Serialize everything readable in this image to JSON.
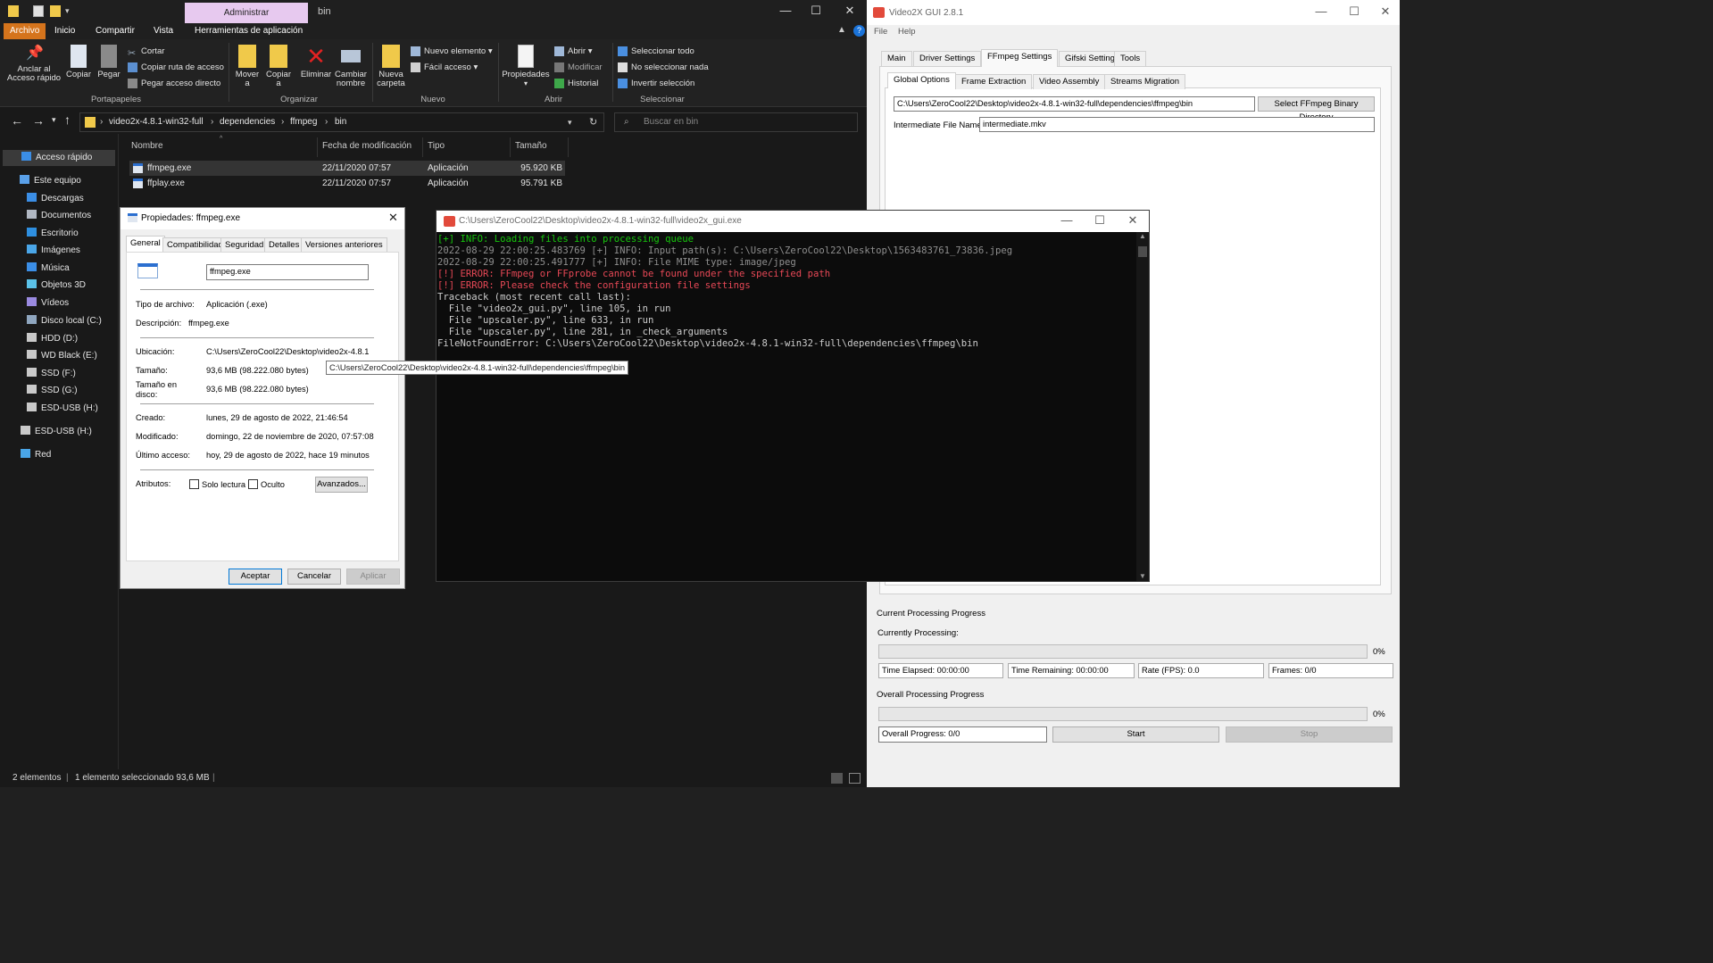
{
  "explorer": {
    "title": "bin",
    "context_tab": "Administrar",
    "tabs": [
      "Archivo",
      "Inicio",
      "Compartir",
      "Vista",
      "Herramientas de aplicación"
    ],
    "ribbon": {
      "pin": "Anclar al Acceso rápido",
      "copy": "Copiar",
      "paste": "Pegar",
      "cut": "Cortar",
      "copy_path": "Copiar ruta de acceso",
      "paste_shortcut": "Pegar acceso directo",
      "move_to": "Mover a",
      "copy_to": "Copiar a",
      "delete": "Eliminar",
      "rename": "Cambiar nombre",
      "new_folder": "Nueva carpeta",
      "new_item": "Nuevo elemento",
      "easy_access": "Fácil acceso",
      "properties": "Propiedades",
      "open": "Abrir",
      "edit": "Modificar",
      "history": "Historial",
      "select_all": "Seleccionar todo",
      "select_none": "No seleccionar nada",
      "invert_selection": "Invertir selección",
      "groups": [
        "Portapapeles",
        "Organizar",
        "Nuevo",
        "Abrir",
        "Seleccionar"
      ]
    },
    "breadcrumb": [
      "video2x-4.8.1-win32-full",
      "dependencies",
      "ffmpeg",
      "bin"
    ],
    "search_placeholder": "Buscar en bin",
    "nav": [
      {
        "label": "Acceso rápido",
        "color": "#3b8ee6"
      },
      {
        "label": "Este equipo",
        "color": "#5aa0e8"
      },
      {
        "label": "Descargas",
        "color": "#3b8ee6"
      },
      {
        "label": "Documentos",
        "color": "#b0b7c2"
      },
      {
        "label": "Escritorio",
        "color": "#2e8fe0"
      },
      {
        "label": "Imágenes",
        "color": "#4aa6e8"
      },
      {
        "label": "Música",
        "color": "#3b8ee6"
      },
      {
        "label": "Objetos 3D",
        "color": "#5bc2e8"
      },
      {
        "label": "Vídeos",
        "color": "#9a8ae0"
      },
      {
        "label": "Disco local (C:)",
        "color": "#8fa6bf"
      },
      {
        "label": "HDD (D:)",
        "color": "#c9c9c9"
      },
      {
        "label": "WD Black (E:)",
        "color": "#c9c9c9"
      },
      {
        "label": "SSD (F:)",
        "color": "#c9c9c9"
      },
      {
        "label": "SSD (G:)",
        "color": "#c9c9c9"
      },
      {
        "label": "ESD-USB (H:)",
        "color": "#c9c9c9"
      },
      {
        "label": "ESD-USB (H:)",
        "color": "#c9c9c9"
      },
      {
        "label": "Red",
        "color": "#4aa6e8"
      }
    ],
    "columns": [
      "Nombre",
      "Fecha de modificación",
      "Tipo",
      "Tamaño"
    ],
    "files": [
      {
        "name": "ffmpeg.exe",
        "date": "22/11/2020 07:57",
        "type": "Aplicación",
        "size": "95.920 KB"
      },
      {
        "name": "ffplay.exe",
        "date": "22/11/2020 07:57",
        "type": "Aplicación",
        "size": "95.791 KB"
      }
    ],
    "status": {
      "count": "2 elementos",
      "selected": "1 elemento seleccionado  93,6 MB"
    }
  },
  "properties": {
    "title": "Propiedades: ffmpeg.exe",
    "tabs": [
      "General",
      "Compatibilidad",
      "Seguridad",
      "Detalles",
      "Versiones anteriores"
    ],
    "filename": "ffmpeg.exe",
    "labels": {
      "type": "Tipo de archivo:",
      "description": "Descripción:",
      "location": "Ubicación:",
      "size": "Tamaño:",
      "size_on_disk": "Tamaño en disco:",
      "created": "Creado:",
      "modified": "Modificado:",
      "accessed": "Último acceso:",
      "attributes": "Atributos:"
    },
    "values": {
      "type": "Aplicación (.exe)",
      "description": "ffmpeg.exe",
      "location": "C:\\Users\\ZeroCool22\\Desktop\\video2x-4.8.1-…",
      "size": "93,6 MB (98.222.080 bytes)",
      "size_on_disk": "93,6 MB (98.222.080 bytes)",
      "created": "lunes, 29 de agosto de 2022, 21:46:54",
      "modified": "domingo, 22 de noviembre de 2020, 07:57:08",
      "accessed": "hoy, 29 de agosto de 2022, hace 19 minutos"
    },
    "readonly": "Solo lectura",
    "hidden": "Oculto",
    "advanced": "Avanzados...",
    "ok": "Aceptar",
    "cancel": "Cancelar",
    "apply": "Aplicar"
  },
  "tooltip": "C:\\Users\\ZeroCool22\\Desktop\\video2x-4.8.1-win32-full\\dependencies\\ffmpeg\\bin",
  "console": {
    "title": "C:\\Users\\ZeroCool22\\Desktop\\video2x-4.8.1-win32-full\\video2x_gui.exe",
    "lines": [
      {
        "text": "[+] INFO: Loading files into processing queue",
        "color": "#16c60c"
      },
      {
        "text": "2022-08-29 22:00:25.483769 [+] INFO: Input path(s): C:\\Users\\ZeroCool22\\Desktop\\1563483761_73836.jpeg",
        "color": "#8f8f8f"
      },
      {
        "text": "2022-08-29 22:00:25.491777 [+] INFO: File MIME type: image/jpeg",
        "color": "#8f8f8f"
      },
      {
        "text": "[!] ERROR: FFmpeg or FFprobe cannot be found under the specified path",
        "color": "#e74856"
      },
      {
        "text": "[!] ERROR: Please check the configuration file settings",
        "color": "#e74856"
      },
      {
        "text": "Traceback (most recent call last):",
        "color": "#cccccc"
      },
      {
        "text": "  File \"video2x_gui.py\", line 105, in run",
        "color": "#cccccc"
      },
      {
        "text": "  File \"upscaler.py\", line 633, in run",
        "color": "#cccccc"
      },
      {
        "text": "  File \"upscaler.py\", line 281, in _check_arguments",
        "color": "#cccccc"
      },
      {
        "text": "FileNotFoundError: C:\\Users\\ZeroCool22\\Desktop\\video2x-4.8.1-win32-full\\dependencies\\ffmpeg\\bin",
        "color": "#cccccc"
      }
    ]
  },
  "video2x": {
    "title": "Video2X GUI 2.8.1",
    "menu": [
      "File",
      "Help"
    ],
    "tabs": [
      "Main",
      "Driver Settings",
      "FFmpeg Settings",
      "Gifski Settings",
      "Tools"
    ],
    "subtabs": [
      "Global Options",
      "Frame Extraction",
      "Video Assembly",
      "Streams Migration"
    ],
    "binary_dir": "C:\\Users\\ZeroCool22\\Desktop\\video2x-4.8.1-win32-full\\dependencies\\ffmpeg\\bin",
    "select_binary_btn": "Select FFmpeg Binary Directory",
    "intermediate_label": "Intermediate File Name",
    "intermediate_value": "intermediate.mkv",
    "current_heading": "Current Processing Progress",
    "currently_processing": "Currently Processing:",
    "current_pct": "0%",
    "current_progress": 0,
    "time_elapsed": "Time Elapsed: 00:00:00",
    "time_remaining": "Time Remaining: 00:00:00",
    "rate": "Rate (FPS): 0.0",
    "frames": "Frames: 0/0",
    "overall_heading": "Overall Processing Progress",
    "overall_pct": "0%",
    "overall_progress": 0,
    "overall_progress_label": "Overall Progress: 0/0",
    "start": "Start",
    "stop": "Stop"
  }
}
